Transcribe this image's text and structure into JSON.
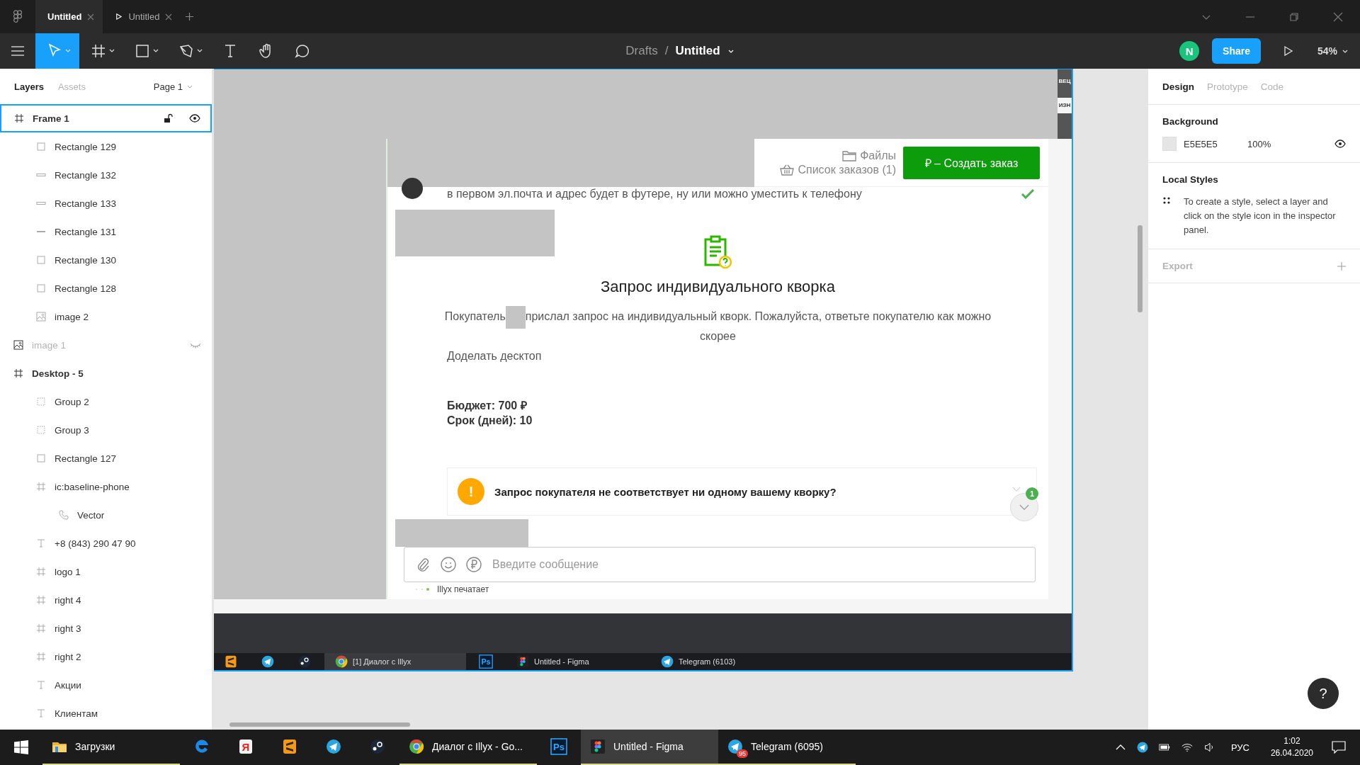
{
  "title_bar": {
    "tabs": [
      {
        "kind": "file",
        "label": "Untitled",
        "selected": true
      },
      {
        "kind": "prototype",
        "label": "Untitled",
        "selected": false
      }
    ]
  },
  "toolbar": {
    "tools": [
      {
        "kind": "move",
        "selected": true
      },
      {
        "kind": "frame",
        "selected": false
      },
      {
        "kind": "rectangle",
        "selected": false
      },
      {
        "kind": "pen",
        "selected": false
      },
      {
        "kind": "text",
        "selected": false
      },
      {
        "kind": "hand",
        "selected": false
      },
      {
        "kind": "comment",
        "selected": false
      }
    ],
    "breadcrumb": {
      "folder": "Drafts",
      "separator": "/",
      "file": "Untitled"
    },
    "avatar": "N",
    "share": "Share",
    "zoom": "54%"
  },
  "layers_panel": {
    "tabs": [
      {
        "label": "Layers",
        "selected": true
      },
      {
        "label": "Assets",
        "selected": false
      }
    ],
    "page": "Page 1",
    "layers": [
      {
        "kind": "frame",
        "name": "Frame 1",
        "selected": true,
        "hidden": false,
        "children": [
          {
            "kind": "rectangle",
            "name": "Rectangle 129",
            "selected": false,
            "hidden": false
          },
          {
            "kind": "bar",
            "name": "Rectangle 132",
            "selected": false,
            "hidden": false
          },
          {
            "kind": "bar",
            "name": "Rectangle 133",
            "selected": false,
            "hidden": false
          },
          {
            "kind": "line",
            "name": "Rectangle 131",
            "selected": false,
            "hidden": false
          },
          {
            "kind": "rectangle",
            "name": "Rectangle 130",
            "selected": false,
            "hidden": false
          },
          {
            "kind": "rectangle",
            "name": "Rectangle 128",
            "selected": false,
            "hidden": false
          },
          {
            "kind": "image",
            "name": "image 2",
            "selected": false,
            "hidden": false
          }
        ]
      },
      {
        "kind": "image",
        "name": "image 1",
        "selected": false,
        "hidden": true
      },
      {
        "kind": "frame",
        "name": "Desktop - 5",
        "selected": false,
        "hidden": false,
        "children": [
          {
            "kind": "group",
            "name": "Group 2",
            "selected": false,
            "hidden": false
          },
          {
            "kind": "group",
            "name": "Group 3",
            "selected": false,
            "hidden": false
          },
          {
            "kind": "rectangle",
            "name": "Rectangle 127",
            "selected": false,
            "hidden": false
          },
          {
            "kind": "frame",
            "name": "ic:baseline-phone",
            "selected": false,
            "hidden": false,
            "children": [
              {
                "kind": "vector",
                "name": "Vector",
                "selected": false,
                "hidden": false
              }
            ]
          },
          {
            "kind": "text",
            "name": "+8 (843) 290 47 90",
            "selected": false,
            "hidden": false
          },
          {
            "kind": "frame",
            "name": "logo 1",
            "selected": false,
            "hidden": false
          },
          {
            "kind": "frame",
            "name": "right 4",
            "selected": false,
            "hidden": false
          },
          {
            "kind": "frame",
            "name": "right 3",
            "selected": false,
            "hidden": false
          },
          {
            "kind": "frame",
            "name": "right 2",
            "selected": false,
            "hidden": false
          },
          {
            "kind": "text",
            "name": "Акции",
            "selected": false,
            "hidden": false
          },
          {
            "kind": "text",
            "name": "Клиентам",
            "selected": false,
            "hidden": false
          }
        ]
      }
    ]
  },
  "frame": {
    "side_texts": [
      "ВЕЦ",
      "ИЗН"
    ],
    "header": {
      "files": "Файлы",
      "orders": "Список заказов (1)",
      "create_button": "₽  – Создать заказ"
    },
    "message": "в первом эл.почта и адрес будет в футере, ну или можно уместить к телефону",
    "request": {
      "title": "Запрос индивидуального кворка",
      "intro_before": "Покупатель",
      "intro_after": "прислал запрос на индивидуальный кворк. Пожалуйста, ответьте покупателю как можно скорее",
      "task": "Доделать десктоп",
      "budget": "Бюджет: 700 ₽",
      "deadline": "Срок (дней): 10"
    },
    "alert": {
      "icon": "!",
      "text": "Запрос покупателя не соответствует ни одному вашему кворку?"
    },
    "unread_badge": "1",
    "composer": {
      "placeholder": "Введите сообщение"
    },
    "typing": "Illyx печатает",
    "taskbar": [
      {
        "kind": "sublime",
        "selected": false
      },
      {
        "kind": "telegram",
        "selected": false
      },
      {
        "kind": "steam",
        "selected": false
      },
      {
        "kind": "chrome",
        "label": "[1] Диалог с Illyx",
        "selected": true
      },
      {
        "kind": "photoshop",
        "glyph": "Ps",
        "selected": false
      },
      {
        "kind": "figma",
        "label": "Untitled - Figma",
        "selected": false
      },
      {
        "kind": "telegram",
        "label": "Telegram (6103)",
        "selected": false
      }
    ]
  },
  "design_panel": {
    "tabs": [
      {
        "label": "Design",
        "selected": true
      },
      {
        "label": "Prototype",
        "selected": false
      },
      {
        "label": "Code",
        "selected": false
      }
    ],
    "background": {
      "title": "Background",
      "hex": "E5E5E5",
      "opacity": "100%"
    },
    "local_styles": {
      "title": "Local Styles",
      "hint": "To create a style, select a layer and click on the style icon in the inspector panel."
    },
    "export": {
      "title": "Export"
    }
  },
  "help": "?",
  "taskbar": {
    "items": [
      {
        "kind": "folder",
        "label": "Загрузки",
        "selected": false,
        "running": true
      },
      {
        "kind": "edge",
        "selected": false,
        "running": false
      },
      {
        "kind": "yandex",
        "glyph": "Я",
        "selected": false,
        "running": false
      },
      {
        "kind": "sublime",
        "selected": false,
        "running": false
      },
      {
        "kind": "telegram",
        "selected": false,
        "running": false
      },
      {
        "kind": "steam",
        "selected": false,
        "running": false
      },
      {
        "kind": "chrome",
        "label": "Диалог с Illyx - Go...",
        "selected": false,
        "running": true
      },
      {
        "kind": "photoshop",
        "glyph": "Ps",
        "selected": false,
        "running": false
      },
      {
        "kind": "figma",
        "label": "Untitled - Figma",
        "selected": true,
        "running": true
      },
      {
        "kind": "telegram",
        "label": "Telegram (6095)",
        "badge": "95",
        "selected": false,
        "running": true
      }
    ],
    "language": "РУС",
    "time": "1:02",
    "date": "26.04.2020"
  }
}
